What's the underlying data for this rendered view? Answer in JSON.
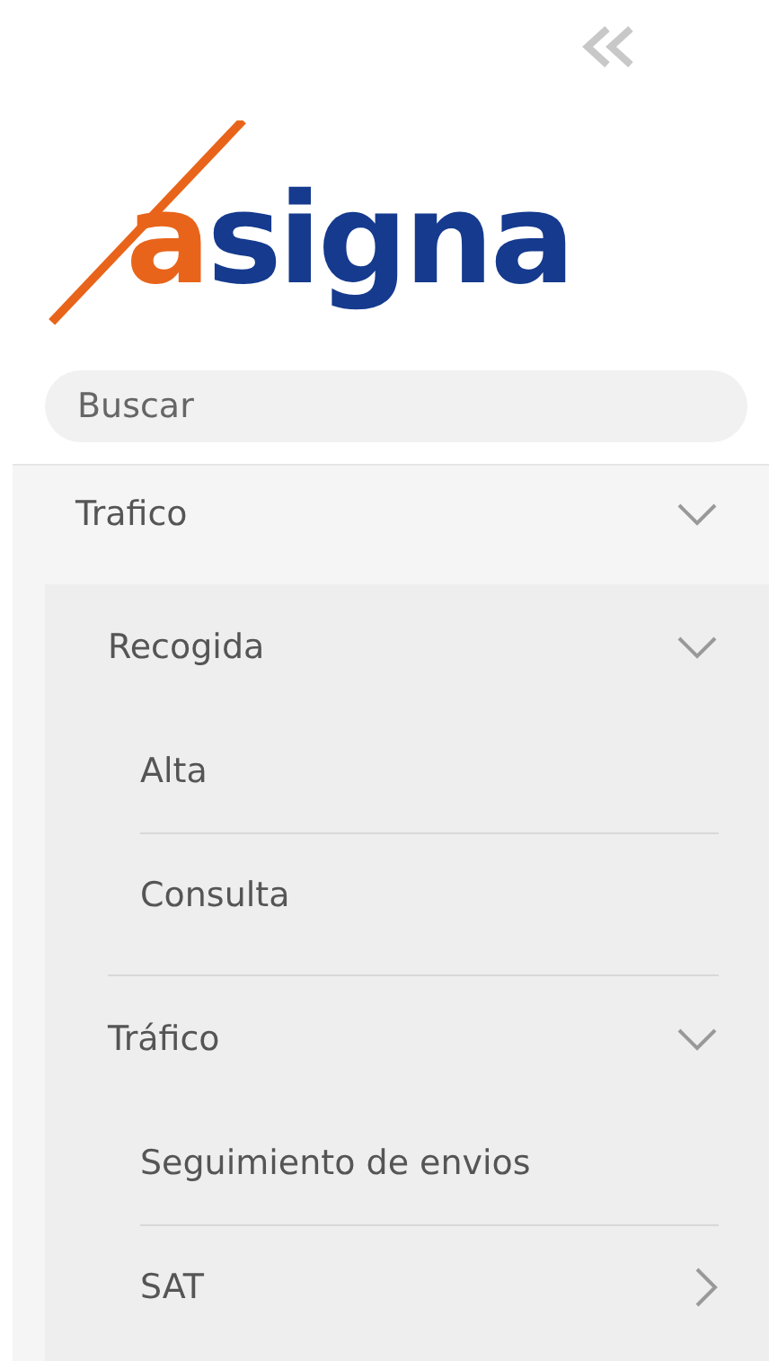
{
  "logo": {
    "text": "asigna"
  },
  "search": {
    "placeholder": "Buscar"
  },
  "menu": [
    {
      "label": "Trafico",
      "expanded": true,
      "children": [
        {
          "label": "Recogida",
          "expanded": true,
          "children": [
            {
              "label": "Alta"
            },
            {
              "label": "Consulta"
            }
          ]
        },
        {
          "label": "Tráfico",
          "expanded": true,
          "children": [
            {
              "label": "Seguimiento de envios"
            },
            {
              "label": "SAT",
              "expanded": false
            }
          ]
        }
      ]
    }
  ]
}
